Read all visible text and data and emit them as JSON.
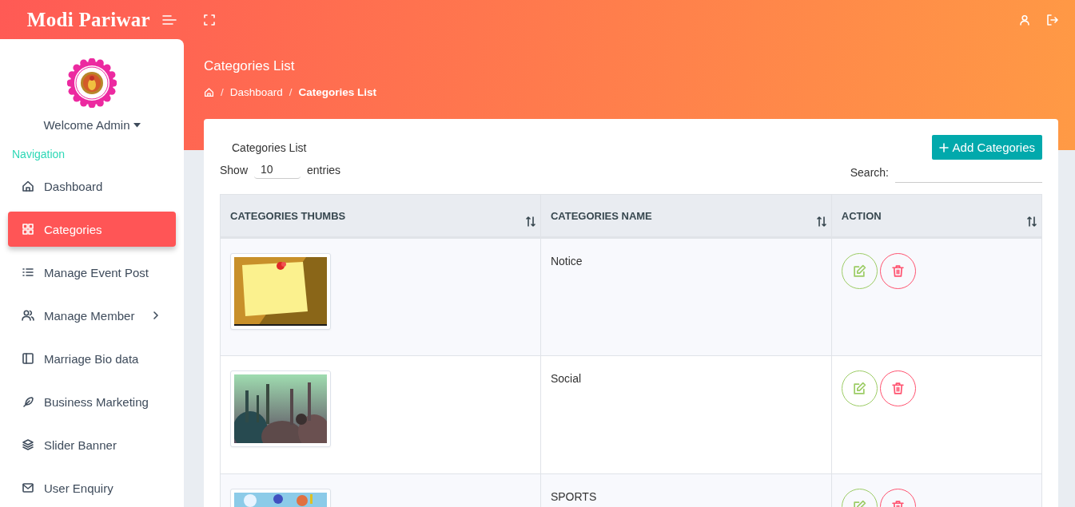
{
  "brand": "Modi Pariwar",
  "user": {
    "welcome": "Welcome Admin"
  },
  "nav_heading": "Navigation",
  "nav": [
    {
      "label": "Dashboard",
      "selected": false,
      "has_submenu": false
    },
    {
      "label": "Categories",
      "selected": true,
      "has_submenu": false
    },
    {
      "label": "Manage Event Post",
      "selected": false,
      "has_submenu": false
    },
    {
      "label": "Manage Member",
      "selected": false,
      "has_submenu": true
    },
    {
      "label": "Marriage Bio data",
      "selected": false,
      "has_submenu": false
    },
    {
      "label": "Business Marketing",
      "selected": false,
      "has_submenu": false
    },
    {
      "label": "Slider Banner",
      "selected": false,
      "has_submenu": false
    },
    {
      "label": "User Enquiry",
      "selected": false,
      "has_submenu": false
    }
  ],
  "page": {
    "title": "Categories List",
    "breadcrumb": [
      {
        "separator": "/",
        "label": "Dashboard"
      },
      {
        "separator": "/",
        "label": "Categories List"
      }
    ]
  },
  "card": {
    "title": "Categories List",
    "add_button": "Add Categories",
    "show_label": "Show",
    "page_size": "10",
    "entries_label": "entries",
    "search_label": "Search:"
  },
  "table": {
    "columns": [
      "CATEGORIES THUMBS",
      "CATEGORIES NAME",
      "ACTION"
    ],
    "rows": [
      {
        "name": "Notice"
      },
      {
        "name": "Social"
      },
      {
        "name": "SPORTS"
      }
    ]
  }
}
